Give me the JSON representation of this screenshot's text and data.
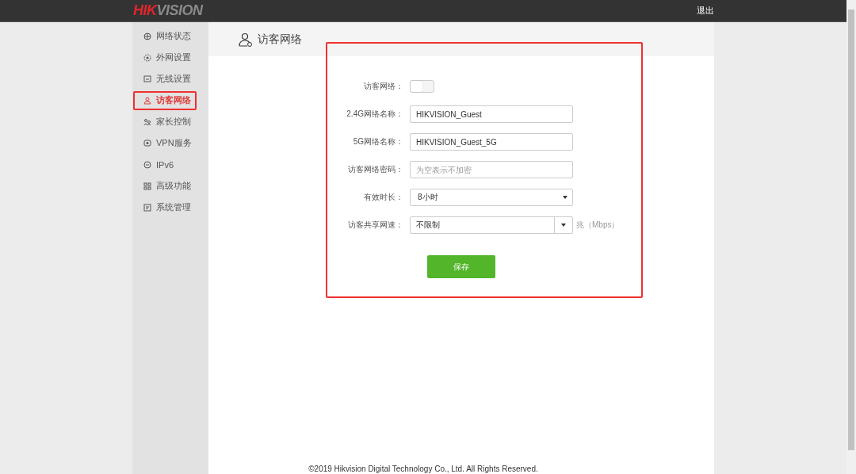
{
  "header": {
    "logo": [
      "HIK",
      "VISION"
    ],
    "logout": "退出"
  },
  "sidebar": {
    "items": [
      {
        "label": "网络状态",
        "selected": false
      },
      {
        "label": "外网设置",
        "selected": false
      },
      {
        "label": "无线设置",
        "selected": false
      },
      {
        "label": "访客网络",
        "selected": true
      },
      {
        "label": "家长控制",
        "selected": false
      },
      {
        "label": "VPN服务",
        "selected": false
      },
      {
        "label": "IPv6",
        "selected": false
      },
      {
        "label": "高级功能",
        "selected": false
      },
      {
        "label": "系统管理",
        "selected": false
      }
    ]
  },
  "page": {
    "title": "访客网络"
  },
  "form": {
    "rows": [
      {
        "kind": "toggle",
        "label": "访客网络：",
        "on": false
      },
      {
        "kind": "text",
        "label": "2.4G网络名称：",
        "value": "HIKVISION_Guest"
      },
      {
        "kind": "text",
        "label": "5G网络名称：",
        "value": "HIKVISION_Guest_5G"
      },
      {
        "kind": "text",
        "label": "访客网络密码：",
        "placeholder": "为空表示不加密"
      },
      {
        "kind": "select",
        "label": "有效时长：",
        "value": "8小时"
      },
      {
        "kind": "combo",
        "label": "访客共享网速：",
        "value": "不限制",
        "unit": "兆（Mbps）"
      }
    ],
    "save": "保存"
  },
  "footer": "©2019 Hikvision Digital Technology Co., Ltd. All Rights Reserved."
}
